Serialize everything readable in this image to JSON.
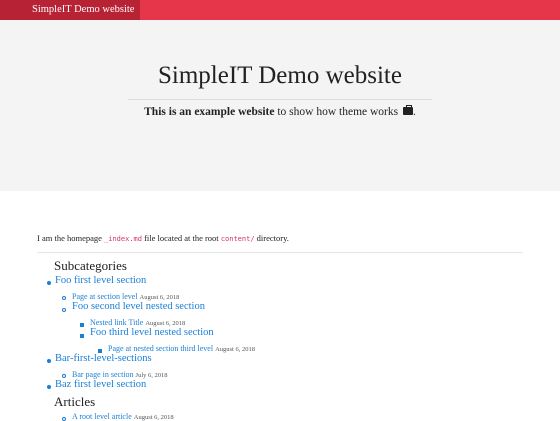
{
  "navbar": {
    "brand": "SimpleIT Demo website"
  },
  "hero": {
    "title": "SimpleIT Demo website",
    "subtitle_bold": "This is an example website",
    "subtitle_rest": " to show how theme works",
    "subtitle_icon": "briefcase-icon",
    "subtitle_end": "."
  },
  "intro": {
    "part1": "I am the homepage ",
    "file": "_index.md",
    "part2": " file located at the root ",
    "dir": "content/",
    "part3": " directory."
  },
  "subcategories": {
    "heading": "Subcategories",
    "items": [
      {
        "label": "Foo first level section"
      },
      {
        "label": "Page at section level",
        "date": "August 6, 2018"
      },
      {
        "label": "Foo second level nested section"
      },
      {
        "label": "Nested link Title",
        "date": "August 6, 2018"
      },
      {
        "label": "Foo third level nested section"
      },
      {
        "label": "Page at nested section third level",
        "date": "August 6, 2018"
      },
      {
        "label": "Bar-first-level-sections"
      },
      {
        "label": "Bar page in section",
        "date": "July 6, 2018"
      },
      {
        "label": "Baz first level section"
      }
    ]
  },
  "articles": {
    "heading": "Articles",
    "items": [
      {
        "label": "A root level article",
        "date": "August 6, 2018"
      }
    ]
  },
  "colors": {
    "topbar": "#e5364a",
    "brand_bg": "#b72234",
    "link": "#1a7fd6",
    "hero_bg": "#f4f4f5"
  }
}
